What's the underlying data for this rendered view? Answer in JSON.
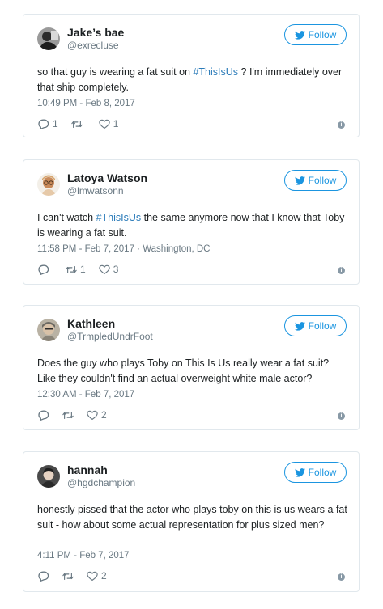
{
  "follow_label": "Follow",
  "accent": "#1b95e0",
  "tweets": [
    {
      "name": "Jake’s bae",
      "handle": "@exrecluse",
      "text_before": "so that guy is wearing a fat suit on ",
      "hashtag": "#ThisIsUs",
      "text_after": " ? I'm immediately over that ship completely.",
      "timestamp": "10:49 PM - Feb 8, 2017",
      "replies": "1",
      "retweets": "",
      "likes": "1"
    },
    {
      "name": "Latoya Watson",
      "handle": "@lmwatsonn",
      "text_before": "I can't watch ",
      "hashtag": "#ThisIsUs",
      "text_after": " the same anymore now that I know that Toby is wearing a fat suit.",
      "timestamp": "11:58 PM - Feb 7, 2017 · Washington, DC",
      "replies": "",
      "retweets": "1",
      "likes": "3"
    },
    {
      "name": "Kathleen",
      "handle": "@TrmpledUndrFoot",
      "text_before": "Does the guy who plays Toby on This Is Us really wear a fat suit? Like they couldn't find an actual overweight white male actor?",
      "hashtag": "",
      "text_after": "",
      "timestamp": "12:30 AM - Feb 7, 2017",
      "replies": "",
      "retweets": "",
      "likes": "2"
    },
    {
      "name": "hannah",
      "handle": "@hgdchampion",
      "text_before": "honestly pissed that the actor who plays toby on this is us wears a fat suit - how about some actual representation for plus sized men?",
      "hashtag": "",
      "text_after": "",
      "timestamp": "4:11 PM - Feb 7, 2017",
      "replies": "",
      "retweets": "",
      "likes": "2"
    }
  ]
}
